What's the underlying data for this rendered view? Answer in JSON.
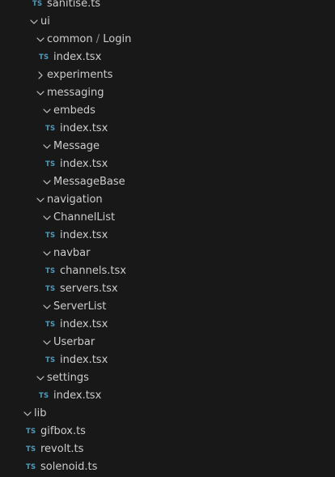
{
  "explorer": {
    "icons": {
      "expanded": "chevron-down-icon",
      "collapsed": "chevron-right-icon",
      "typescript": "ts-file-icon",
      "typescript_label": "TS"
    },
    "colors": {
      "background": "#181818",
      "text": "#cccccc",
      "typescript_icon": "#519aba",
      "chevron": "#c5c5c5"
    },
    "items": [
      {
        "kind": "file",
        "depth": 1,
        "label": "sanitise.ts"
      },
      {
        "kind": "folder",
        "depth": 1,
        "label": "ui",
        "expanded": true
      },
      {
        "kind": "folder",
        "depth": 2,
        "label": "common",
        "label_sep": "/",
        "label_tail": "Login",
        "expanded": true
      },
      {
        "kind": "file",
        "depth": 2,
        "label": "index.tsx"
      },
      {
        "kind": "folder",
        "depth": 2,
        "label": "experiments",
        "expanded": false
      },
      {
        "kind": "folder",
        "depth": 2,
        "label": "messaging",
        "expanded": true
      },
      {
        "kind": "folder",
        "depth": 3,
        "label": "embeds",
        "expanded": true
      },
      {
        "kind": "file",
        "depth": 3,
        "label": "index.tsx"
      },
      {
        "kind": "folder",
        "depth": 3,
        "label": "Message",
        "expanded": true
      },
      {
        "kind": "file",
        "depth": 3,
        "label": "index.tsx"
      },
      {
        "kind": "folder",
        "depth": 3,
        "label": "MessageBase",
        "expanded": true
      },
      {
        "kind": "folder",
        "depth": 2,
        "label": "navigation",
        "expanded": true
      },
      {
        "kind": "folder",
        "depth": 3,
        "label": "ChannelList",
        "expanded": true
      },
      {
        "kind": "file",
        "depth": 3,
        "label": "index.tsx"
      },
      {
        "kind": "folder",
        "depth": 3,
        "label": "navbar",
        "expanded": true
      },
      {
        "kind": "file",
        "depth": 3,
        "label": "channels.tsx"
      },
      {
        "kind": "file",
        "depth": 3,
        "label": "servers.tsx"
      },
      {
        "kind": "folder",
        "depth": 3,
        "label": "ServerList",
        "expanded": true
      },
      {
        "kind": "file",
        "depth": 3,
        "label": "index.tsx"
      },
      {
        "kind": "folder",
        "depth": 3,
        "label": "Userbar",
        "expanded": true
      },
      {
        "kind": "file",
        "depth": 3,
        "label": "index.tsx"
      },
      {
        "kind": "folder",
        "depth": 2,
        "label": "settings",
        "expanded": true
      },
      {
        "kind": "file",
        "depth": 2,
        "label": "index.tsx"
      },
      {
        "kind": "folder",
        "depth": 0,
        "label": "lib",
        "expanded": true
      },
      {
        "kind": "file",
        "depth": 0,
        "label": "gifbox.ts"
      },
      {
        "kind": "file",
        "depth": 0,
        "label": "revolt.ts"
      },
      {
        "kind": "file",
        "depth": 0,
        "label": "solenoid.ts"
      }
    ]
  }
}
